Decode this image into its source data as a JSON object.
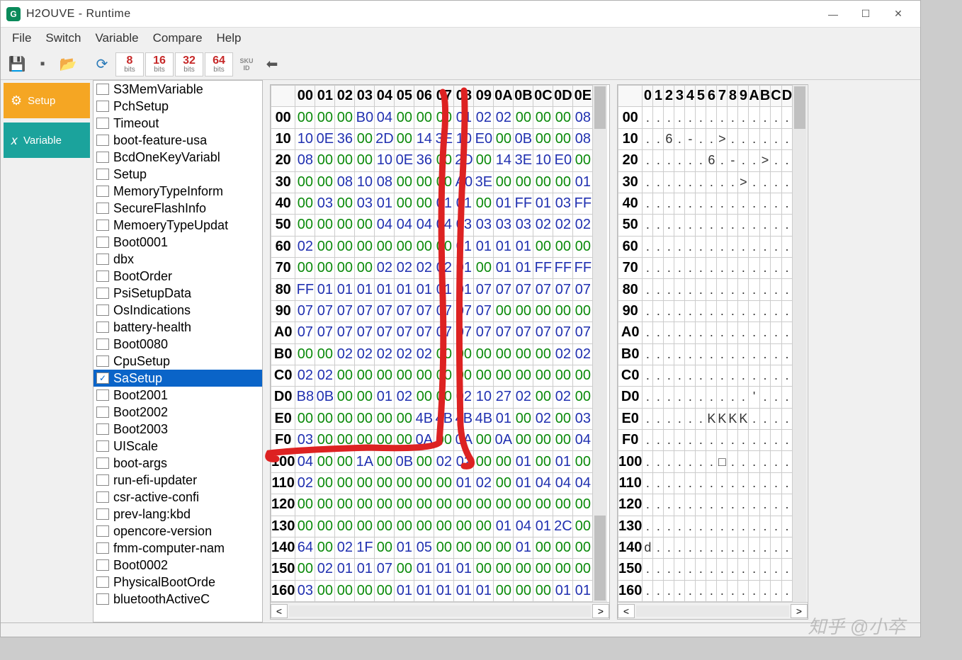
{
  "title": "H2OUVE - Runtime",
  "menu": [
    "File",
    "Switch",
    "Variable",
    "Compare",
    "Help"
  ],
  "bits": [
    {
      "n": "8",
      "l": "bits"
    },
    {
      "n": "16",
      "l": "bits"
    },
    {
      "n": "32",
      "l": "bits"
    },
    {
      "n": "64",
      "l": "bits"
    }
  ],
  "sku": {
    "l1": "SKU",
    "l2": "ID"
  },
  "leftnav": {
    "setup": "Setup",
    "variable": "Variable"
  },
  "variables": [
    {
      "name": "S3MemVariable",
      "sel": false
    },
    {
      "name": "PchSetup",
      "sel": false
    },
    {
      "name": "Timeout",
      "sel": false
    },
    {
      "name": "boot-feature-usa",
      "sel": false
    },
    {
      "name": "BcdOneKeyVariabl",
      "sel": false
    },
    {
      "name": "Setup",
      "sel": false
    },
    {
      "name": "MemoryTypeInform",
      "sel": false
    },
    {
      "name": "SecureFlashInfo",
      "sel": false
    },
    {
      "name": "MemoeryTypeUpdat",
      "sel": false
    },
    {
      "name": "Boot0001",
      "sel": false
    },
    {
      "name": "dbx",
      "sel": false
    },
    {
      "name": "BootOrder",
      "sel": false
    },
    {
      "name": "PsiSetupData",
      "sel": false
    },
    {
      "name": "OsIndications",
      "sel": false
    },
    {
      "name": "battery-health",
      "sel": false
    },
    {
      "name": "Boot0080",
      "sel": false
    },
    {
      "name": "CpuSetup",
      "sel": false
    },
    {
      "name": "SaSetup",
      "sel": true
    },
    {
      "name": "Boot2001",
      "sel": false
    },
    {
      "name": "Boot2002",
      "sel": false
    },
    {
      "name": "Boot2003",
      "sel": false
    },
    {
      "name": "UIScale",
      "sel": false
    },
    {
      "name": "boot-args",
      "sel": false
    },
    {
      "name": "run-efi-updater",
      "sel": false
    },
    {
      "name": "csr-active-confi",
      "sel": false
    },
    {
      "name": "prev-lang:kbd",
      "sel": false
    },
    {
      "name": "opencore-version",
      "sel": false
    },
    {
      "name": "fmm-computer-nam",
      "sel": false
    },
    {
      "name": "Boot0002",
      "sel": false
    },
    {
      "name": "PhysicalBootOrde",
      "sel": false
    },
    {
      "name": "bluetoothActiveC",
      "sel": false
    }
  ],
  "hex": {
    "cols": [
      "00",
      "01",
      "02",
      "03",
      "04",
      "05",
      "06",
      "07",
      "08",
      "09",
      "0A",
      "0B",
      "0C",
      "0D",
      "0E"
    ],
    "ascii_cols": [
      "0",
      "1",
      "2",
      "3",
      "4",
      "5",
      "6",
      "7",
      "8",
      "9",
      "A",
      "B",
      "C",
      "D"
    ],
    "rows": [
      {
        "addr": "00",
        "v": [
          "00",
          "00",
          "00",
          "B0",
          "04",
          "00",
          "00",
          "00",
          "01",
          "02",
          "02",
          "00",
          "00",
          "00",
          "08"
        ],
        "a": [
          ".",
          ".",
          ".",
          ".",
          ".",
          ".",
          ".",
          ".",
          ".",
          ".",
          ".",
          ".",
          ".",
          "."
        ]
      },
      {
        "addr": "10",
        "v": [
          "10",
          "0E",
          "36",
          "00",
          "2D",
          "00",
          "14",
          "3E",
          "10",
          "E0",
          "00",
          "0B",
          "00",
          "00",
          "08"
        ],
        "a": [
          ".",
          ".",
          "6",
          ".",
          "-",
          ".",
          ".",
          ">",
          ".",
          ".",
          ".",
          ".",
          ".",
          "."
        ]
      },
      {
        "addr": "20",
        "v": [
          "08",
          "00",
          "00",
          "00",
          "10",
          "0E",
          "36",
          "00",
          "2D",
          "00",
          "14",
          "3E",
          "10",
          "E0",
          "00"
        ],
        "a": [
          ".",
          ".",
          ".",
          ".",
          ".",
          ".",
          "6",
          ".",
          "-",
          ".",
          ".",
          ">",
          ".",
          "."
        ]
      },
      {
        "addr": "30",
        "v": [
          "00",
          "00",
          "08",
          "10",
          "08",
          "00",
          "00",
          "00",
          "A0",
          "3E",
          "00",
          "00",
          "00",
          "00",
          "01"
        ],
        "a": [
          ".",
          ".",
          ".",
          ".",
          ".",
          ".",
          ".",
          ".",
          ".",
          ">",
          ".",
          ".",
          ".",
          "."
        ]
      },
      {
        "addr": "40",
        "v": [
          "00",
          "03",
          "00",
          "03",
          "01",
          "00",
          "00",
          "01",
          "01",
          "00",
          "01",
          "FF",
          "01",
          "03",
          "FF"
        ],
        "a": [
          ".",
          ".",
          ".",
          ".",
          ".",
          ".",
          ".",
          ".",
          ".",
          ".",
          ".",
          ".",
          ".",
          "."
        ]
      },
      {
        "addr": "50",
        "v": [
          "00",
          "00",
          "00",
          "00",
          "04",
          "04",
          "04",
          "04",
          "03",
          "03",
          "03",
          "03",
          "02",
          "02",
          "02"
        ],
        "a": [
          ".",
          ".",
          ".",
          ".",
          ".",
          ".",
          ".",
          ".",
          ".",
          ".",
          ".",
          ".",
          ".",
          "."
        ]
      },
      {
        "addr": "60",
        "v": [
          "02",
          "00",
          "00",
          "00",
          "00",
          "00",
          "00",
          "00",
          "01",
          "01",
          "01",
          "01",
          "00",
          "00",
          "00"
        ],
        "a": [
          ".",
          ".",
          ".",
          ".",
          ".",
          ".",
          ".",
          ".",
          ".",
          ".",
          ".",
          ".",
          ".",
          "."
        ]
      },
      {
        "addr": "70",
        "v": [
          "00",
          "00",
          "00",
          "00",
          "02",
          "02",
          "02",
          "02",
          "01",
          "00",
          "01",
          "01",
          "FF",
          "FF",
          "FF"
        ],
        "a": [
          ".",
          ".",
          ".",
          ".",
          ".",
          ".",
          ".",
          ".",
          ".",
          ".",
          ".",
          ".",
          ".",
          "."
        ]
      },
      {
        "addr": "80",
        "v": [
          "FF",
          "01",
          "01",
          "01",
          "01",
          "01",
          "01",
          "01",
          "01",
          "07",
          "07",
          "07",
          "07",
          "07",
          "07"
        ],
        "a": [
          ".",
          ".",
          ".",
          ".",
          ".",
          ".",
          ".",
          ".",
          ".",
          ".",
          ".",
          ".",
          ".",
          "."
        ]
      },
      {
        "addr": "90",
        "v": [
          "07",
          "07",
          "07",
          "07",
          "07",
          "07",
          "07",
          "07",
          "07",
          "07",
          "00",
          "00",
          "00",
          "00",
          "00"
        ],
        "a": [
          ".",
          ".",
          ".",
          ".",
          ".",
          ".",
          ".",
          ".",
          ".",
          ".",
          ".",
          ".",
          ".",
          "."
        ]
      },
      {
        "addr": "A0",
        "v": [
          "07",
          "07",
          "07",
          "07",
          "07",
          "07",
          "07",
          "07",
          "07",
          "07",
          "07",
          "07",
          "07",
          "07",
          "07"
        ],
        "a": [
          ".",
          ".",
          ".",
          ".",
          ".",
          ".",
          ".",
          ".",
          ".",
          ".",
          ".",
          ".",
          ".",
          "."
        ]
      },
      {
        "addr": "B0",
        "v": [
          "00",
          "00",
          "02",
          "02",
          "02",
          "02",
          "02",
          "00",
          "00",
          "00",
          "00",
          "00",
          "00",
          "02",
          "02"
        ],
        "a": [
          ".",
          ".",
          ".",
          ".",
          ".",
          ".",
          ".",
          ".",
          ".",
          ".",
          ".",
          ".",
          ".",
          "."
        ]
      },
      {
        "addr": "C0",
        "v": [
          "02",
          "02",
          "00",
          "00",
          "00",
          "00",
          "00",
          "00",
          "00",
          "00",
          "00",
          "00",
          "00",
          "00",
          "00"
        ],
        "a": [
          ".",
          ".",
          ".",
          ".",
          ".",
          ".",
          ".",
          ".",
          ".",
          ".",
          ".",
          ".",
          ".",
          "."
        ]
      },
      {
        "addr": "D0",
        "v": [
          "B8",
          "0B",
          "00",
          "00",
          "01",
          "02",
          "00",
          "00",
          "02",
          "10",
          "27",
          "02",
          "00",
          "02",
          "00"
        ],
        "a": [
          ".",
          ".",
          ".",
          ".",
          ".",
          ".",
          ".",
          ".",
          ".",
          ".",
          "'",
          ".",
          ".",
          "."
        ]
      },
      {
        "addr": "E0",
        "v": [
          "00",
          "00",
          "00",
          "00",
          "00",
          "00",
          "4B",
          "4B",
          "4B",
          "4B",
          "01",
          "00",
          "02",
          "00",
          "03"
        ],
        "a": [
          ".",
          ".",
          ".",
          ".",
          ".",
          ".",
          "K",
          "K",
          "K",
          "K",
          ".",
          ".",
          ".",
          "."
        ]
      },
      {
        "addr": "F0",
        "v": [
          "03",
          "00",
          "00",
          "00",
          "00",
          "00",
          "0A",
          "00",
          "0A",
          "00",
          "0A",
          "00",
          "00",
          "00",
          "04"
        ],
        "a": [
          ".",
          ".",
          ".",
          ".",
          ".",
          ".",
          ".",
          ".",
          ".",
          ".",
          ".",
          ".",
          ".",
          "."
        ]
      },
      {
        "addr": "100",
        "v": [
          "04",
          "00",
          "00",
          "1A",
          "00",
          "0B",
          "00",
          "02",
          "02",
          "00",
          "00",
          "01",
          "00",
          "01",
          "00"
        ],
        "a": [
          ".",
          ".",
          ".",
          ".",
          ".",
          ".",
          ".",
          "□",
          ".",
          ".",
          ".",
          ".",
          ".",
          "."
        ]
      },
      {
        "addr": "110",
        "v": [
          "02",
          "00",
          "00",
          "00",
          "00",
          "00",
          "00",
          "00",
          "01",
          "02",
          "00",
          "01",
          "04",
          "04",
          "04"
        ],
        "a": [
          ".",
          ".",
          ".",
          ".",
          ".",
          ".",
          ".",
          ".",
          ".",
          ".",
          ".",
          ".",
          ".",
          "."
        ]
      },
      {
        "addr": "120",
        "v": [
          "00",
          "00",
          "00",
          "00",
          "00",
          "00",
          "00",
          "00",
          "00",
          "00",
          "00",
          "00",
          "00",
          "00",
          "00"
        ],
        "a": [
          ".",
          ".",
          ".",
          ".",
          ".",
          ".",
          ".",
          ".",
          ".",
          ".",
          ".",
          ".",
          ".",
          "."
        ]
      },
      {
        "addr": "130",
        "v": [
          "00",
          "00",
          "00",
          "00",
          "00",
          "00",
          "00",
          "00",
          "00",
          "00",
          "01",
          "04",
          "01",
          "2C",
          "00"
        ],
        "a": [
          ".",
          ".",
          ".",
          ".",
          ".",
          ".",
          ".",
          ".",
          ".",
          ".",
          ".",
          ".",
          ".",
          "."
        ]
      },
      {
        "addr": "140",
        "v": [
          "64",
          "00",
          "02",
          "1F",
          "00",
          "01",
          "05",
          "00",
          "00",
          "00",
          "00",
          "01",
          "00",
          "00",
          "00"
        ],
        "a": [
          "d",
          ".",
          ".",
          ".",
          ".",
          ".",
          ".",
          ".",
          ".",
          ".",
          ".",
          ".",
          ".",
          "."
        ]
      },
      {
        "addr": "150",
        "v": [
          "00",
          "02",
          "01",
          "01",
          "07",
          "00",
          "01",
          "01",
          "01",
          "00",
          "00",
          "00",
          "00",
          "00",
          "00"
        ],
        "a": [
          ".",
          ".",
          ".",
          ".",
          ".",
          ".",
          ".",
          ".",
          ".",
          ".",
          ".",
          ".",
          ".",
          "."
        ]
      },
      {
        "addr": "160",
        "v": [
          "03",
          "00",
          "00",
          "00",
          "00",
          "01",
          "01",
          "01",
          "01",
          "01",
          "00",
          "00",
          "00",
          "01",
          "01"
        ],
        "a": [
          ".",
          ".",
          ".",
          ".",
          ".",
          ".",
          ".",
          ".",
          ".",
          ".",
          ".",
          ".",
          ".",
          "."
        ]
      }
    ]
  },
  "watermark": "知乎 @小卒"
}
